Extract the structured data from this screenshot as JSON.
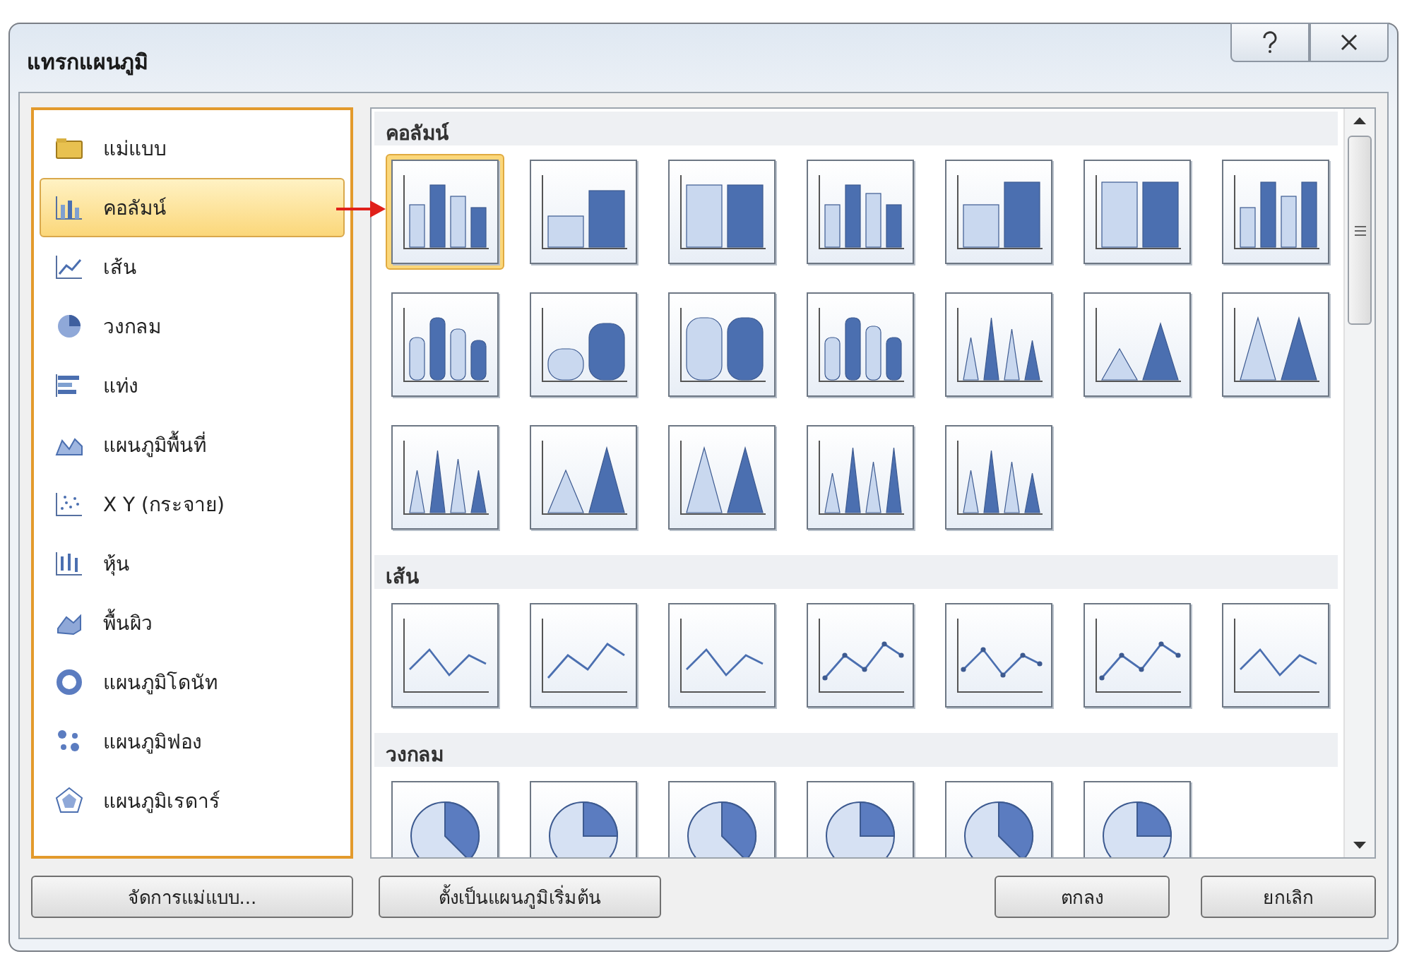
{
  "window": {
    "title": "แทรกแผนภูมิ"
  },
  "sidebar": {
    "items": [
      {
        "label": "แม่แบบ",
        "selected": false
      },
      {
        "label": "คอลัมน์",
        "selected": true
      },
      {
        "label": "เส้น",
        "selected": false
      },
      {
        "label": "วงกลม",
        "selected": false
      },
      {
        "label": "แท่ง",
        "selected": false
      },
      {
        "label": "แผนภูมิพื้นที่",
        "selected": false
      },
      {
        "label": "X Y (กระจาย)",
        "selected": false
      },
      {
        "label": "หุ้น",
        "selected": false
      },
      {
        "label": "พื้นผิว",
        "selected": false
      },
      {
        "label": "แผนภูมิโดนัท",
        "selected": false
      },
      {
        "label": "แผนภูมิฟอง",
        "selected": false
      },
      {
        "label": "แผนภูมิเรดาร์",
        "selected": false
      }
    ]
  },
  "gallery": {
    "sections": [
      {
        "title": "คอลัมน์",
        "kind": "column",
        "charts": [
          {
            "selected": true
          },
          {
            "selected": false
          },
          {
            "selected": false
          },
          {
            "selected": false
          },
          {
            "selected": false
          },
          {
            "selected": false
          },
          {
            "selected": false
          },
          {
            "selected": false
          },
          {
            "selected": false
          },
          {
            "selected": false
          },
          {
            "selected": false
          },
          {
            "selected": false
          },
          {
            "selected": false
          },
          {
            "selected": false
          },
          {
            "selected": false
          },
          {
            "selected": false
          },
          {
            "selected": false
          },
          {
            "selected": false
          },
          {
            "selected": false
          }
        ]
      },
      {
        "title": "เส้น",
        "kind": "line",
        "charts": [
          {
            "selected": false
          },
          {
            "selected": false
          },
          {
            "selected": false
          },
          {
            "selected": false
          },
          {
            "selected": false
          },
          {
            "selected": false
          },
          {
            "selected": false
          }
        ]
      },
      {
        "title": "วงกลม",
        "kind": "pie",
        "charts": [
          {
            "selected": false
          },
          {
            "selected": false
          },
          {
            "selected": false
          },
          {
            "selected": false
          },
          {
            "selected": false
          },
          {
            "selected": false
          }
        ]
      }
    ]
  },
  "footer": {
    "left_buttons": [
      "จัดการแม่แบบ...",
      "ตั้งเป็นแผนภูมิเริ่มต้น"
    ],
    "right_buttons": [
      "ตกลง",
      "ยกเลิก"
    ]
  }
}
